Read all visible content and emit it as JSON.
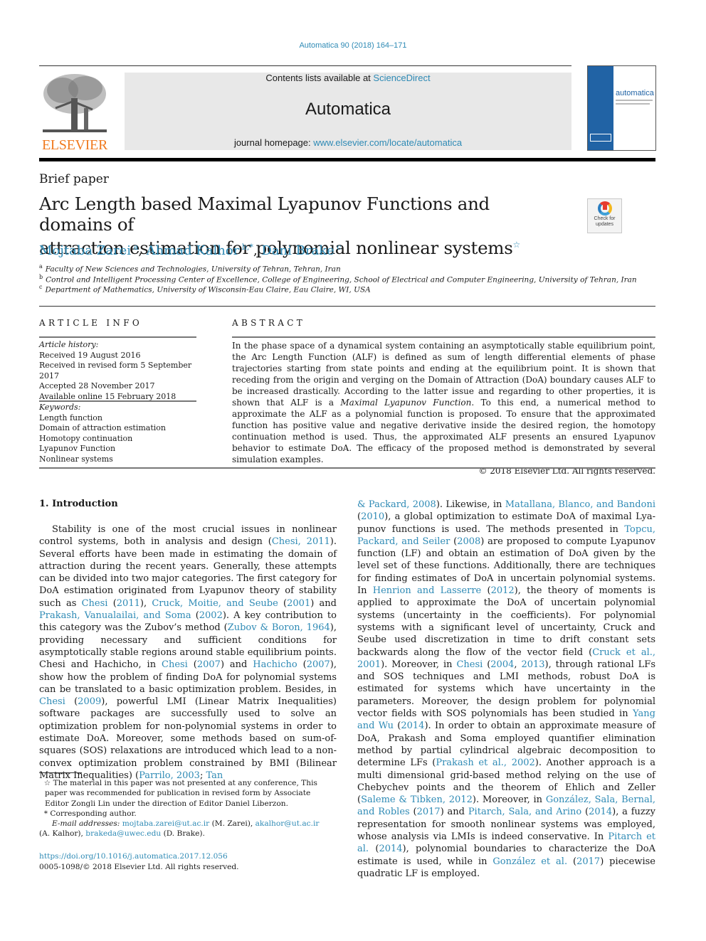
{
  "header": {
    "journal_ref": "Automatica 90 (2018) 164–171",
    "contents_prefix": "Contents lists available at ",
    "contents_link": "ScienceDirect",
    "journal_name": "Automatica",
    "homepage_prefix": "journal homepage: ",
    "homepage_link": "www.elsevier.com/locate/automatica",
    "publisher_logo_text": "ELSEVIER",
    "cover_title": "automatica",
    "crossmark_label_1": "Check for",
    "crossmark_label_2": "updates"
  },
  "article": {
    "type": "Brief paper",
    "title_line1": "Arc Length based Maximal Lyapunov Functions and domains of",
    "title_line2": "attraction estimation for polynomial nonlinear systems",
    "title_mark": "☆",
    "authors": [
      {
        "name": "Mojtaba Zarei",
        "sup": "a"
      },
      {
        "name": "Ahmad Kalhor",
        "sup": "b,*"
      },
      {
        "name": "Dani Brake",
        "sup": "c"
      }
    ],
    "affiliations": [
      {
        "sup": "a",
        "text": "Faculty of New Sciences and Technologies, University of Tehran, Tehran, Iran"
      },
      {
        "sup": "b",
        "text": "Control and Intelligent Processing Center of Excellence, College of Engineering, School of Electrical and Computer Engineering, University of Tehran, Iran"
      },
      {
        "sup": "c",
        "text": "Department of Mathematics, University of Wisconsin-Eau Claire, Eau Claire, WI, USA"
      }
    ]
  },
  "article_info": {
    "heading": "ARTICLE INFO",
    "history_heading": "Article history:",
    "history": [
      "Received 19 August 2016",
      "Received in revised form 5 September 2017",
      "Accepted 28 November 2017",
      "Available online 15 February 2018"
    ],
    "keywords_heading": "Keywords:",
    "keywords": [
      "Length function",
      "Domain of attraction estimation",
      "Homotopy continuation",
      "Lyapunov Function",
      "Nonlinear systems"
    ]
  },
  "abstract": {
    "heading": "ABSTRACT",
    "text_before_em": "In the phase space of a dynamical system containing an asymptotically stable equilibrium point, the Arc Length Function (ALF) is defined as sum of length differential elements of phase trajectories starting from state points and ending at the equilibrium point. It is shown that receding from the origin and verging on the Domain of Attraction (DoA) boundary causes ALF to be increased drastically. According to the latter issue and regarding to other properties, it is shown that ALF is a ",
    "em": "Maximal Lyapunov Function",
    "text_after_em": ". To this end, a numerical method to approximate the ALF as a polynomial function is proposed. To ensure that the approximated function has positive value and negative derivative inside the desired region, the homotopy continuation method is used. Thus, the approximated ALF presents an ensured Lyapunov behavior to estimate DoA. The efficacy of the proposed method is demonstrated by several simulation examples.",
    "copyright": "© 2018 Elsevier Ltd. All rights reserved."
  },
  "introduction": {
    "heading": "1.  Introduction",
    "left_segments": [
      {
        "t": "Stability is one of the most crucial issues in nonlinear control systems, both in analysis and design  ("
      },
      {
        "l": "Chesi, 2011"
      },
      {
        "t": "). Several efforts have been made in estimating the domain of attraction during the recent years. Generally, these attempts can be divided into two major categories. The first category for DoA estimation orig­inated from Lyapunov theory of stability such as  "
      },
      {
        "l": "Chesi"
      },
      {
        "t": " ("
      },
      {
        "l": "2011"
      },
      {
        "t": "), "
      },
      {
        "l": "Cruck, Moitie, and Seube"
      },
      {
        "t": " ("
      },
      {
        "l": "2001"
      },
      {
        "t": ") and "
      },
      {
        "l": "Prakash, Vanualailai, and Soma"
      },
      {
        "t": " ("
      },
      {
        "l": "2002"
      },
      {
        "t": "). A key contribution to this category was the Zubov’s method  ("
      },
      {
        "l": "Zubov & Boron, 1964"
      },
      {
        "t": "), providing necessary and sufficient conditions for asymptotically stable regions around stable equilib­rium points. Chesi and Hachicho, in  "
      },
      {
        "l": "Chesi"
      },
      {
        "t": " ("
      },
      {
        "l": "2007"
      },
      {
        "t": ") and "
      },
      {
        "l": "Hachicho"
      },
      {
        "t": " ("
      },
      {
        "l": "2007"
      },
      {
        "t": "), show how the problem of finding DoA for polynomial systems can be translated to a basic optimization problem. Besides, in "
      },
      {
        "l": "Chesi"
      },
      {
        "t": " ("
      },
      {
        "l": "2009"
      },
      {
        "t": "), powerful LMI (Linear Matrix Inequalities) software packages are successfully used to solve an optimization problem for non-polynomial systems in order to estimate DoA. Moreover, some methods based on sum-of-squares (SOS) relaxations are in­troduced which lead to a non-convex optimization problem con­strained by BMI (Bilinear Matrix Inequalities)  ("
      },
      {
        "l": "Parrilo, 2003"
      },
      {
        "t": "; "
      },
      {
        "l": "Tan"
      }
    ],
    "right_segments": [
      {
        "l": "& Packard, 2008"
      },
      {
        "t": "). Likewise, in  "
      },
      {
        "l": "Matallana, Blanco, and Bandoni"
      },
      {
        "t": " ("
      },
      {
        "l": "2010"
      },
      {
        "t": "), a global optimization to estimate DoA of maximal Lya­punov functions is used. The methods presented in "
      },
      {
        "l": "Topcu, Packard, and Seiler"
      },
      {
        "t": " ("
      },
      {
        "l": "2008"
      },
      {
        "t": ") are proposed to compute Lyapunov function (LF) and obtain an estimation of DoA given by the level set of these functions. Additionally, there are techniques for finding estimates of DoA in uncertain polynomial systems. In  "
      },
      {
        "l": "Henrion and Lasserre"
      },
      {
        "t": " ("
      },
      {
        "l": "2012"
      },
      {
        "t": "), the theory of moments is applied to approximate the DoA of uncertain polynomial systems (uncertainty in the coefficients). For polynomial systems with a significant level of uncertainty, Cruck and Seube used discretization in time to drift constant sets backwards along the flow of the vector field  ("
      },
      {
        "l": "Cruck et al., 2001"
      },
      {
        "t": "). Moreover, in  "
      },
      {
        "l": "Chesi"
      },
      {
        "t": " ("
      },
      {
        "l": "2004"
      },
      {
        "t": ", "
      },
      {
        "l": "2013"
      },
      {
        "t": "), through rational LFs and SOS techniques and LMI methods, robust DoA is estimated for systems which have uncertainty in the parameters. Moreover, the design problem for polynomial vector fields with SOS polynomials has been studied in "
      },
      {
        "l": "Yang and Wu"
      },
      {
        "t": " ("
      },
      {
        "l": "2014"
      },
      {
        "t": "). In order to obtain an ap­proximate measure of DoA, Prakash and Soma employed quantifier elimination method by partial cylindrical algebraic decomposition to determine LFs ("
      },
      {
        "l": "Prakash et al., 2002"
      },
      {
        "t": "). Another approach is a multi dimensional grid-based method relying on the use of Chebychev points and the theorem of Ehlich and Zeller  ("
      },
      {
        "l": "Saleme & Tibken, 2012"
      },
      {
        "t": "). Moreover, in "
      },
      {
        "l": "González, Sala, Bernal, and Robles"
      },
      {
        "t": " ("
      },
      {
        "l": "2017"
      },
      {
        "t": ") and "
      },
      {
        "l": "Pitarch, Sala, and Arino"
      },
      {
        "t": " ("
      },
      {
        "l": "2014"
      },
      {
        "t": "), a fuzzy representation for smooth nonlinear systems was employed, whose analysis via LMIs is in­deed conservative. In  "
      },
      {
        "l": "Pitarch et al."
      },
      {
        "t": " ("
      },
      {
        "l": "2014"
      },
      {
        "t": "), polynomial boundaries to characterize the DoA estimate is used, while in  "
      },
      {
        "l": "González et al."
      },
      {
        "t": " ("
      },
      {
        "l": "2017"
      },
      {
        "t": ") piecewise quadratic LF is employed."
      }
    ]
  },
  "footnotes": {
    "star_mark": "☆",
    "star_text": "The material in this paper was not presented at any conference, This paper was recommended for publication in revised form by Associate Editor Zongli Lin under the direction of Editor Daniel Liberzon.",
    "corr_mark": "*",
    "corr_text": "Corresponding author.",
    "email_label": "E-mail addresses:",
    "emails": [
      {
        "addr": "mojtaba.zarei@ut.ac.ir",
        "who": "(M. Zarei)"
      },
      {
        "addr": "akalhor@ut.ac.ir",
        "who": "(A. Kalhor)"
      },
      {
        "addr": "brakeda@uwec.edu",
        "who": "(D. Brake)."
      }
    ],
    "doi": "https://doi.org/10.1016/j.automatica.2017.12.056",
    "issn_copyright": "0005-1098/© 2018 Elsevier Ltd. All rights reserved."
  },
  "colors": {
    "link": "#2e8ab5",
    "elsevier_orange": "#f07a1f",
    "header_gray": "#e8e8e8",
    "cover_blue": "#2163a5"
  }
}
